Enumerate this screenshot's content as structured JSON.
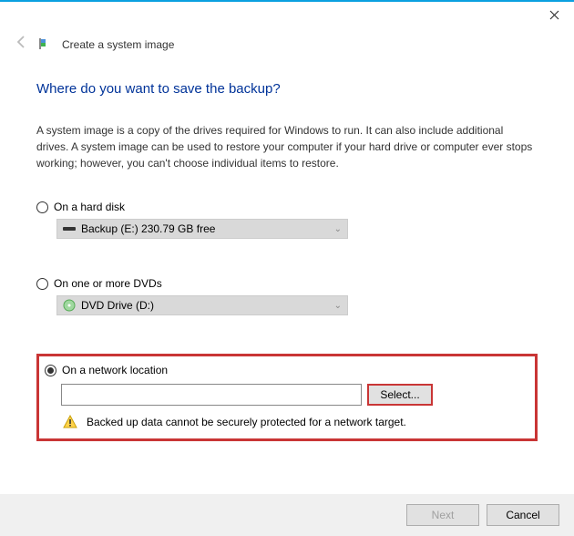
{
  "header": {
    "title": "Create a system image"
  },
  "main": {
    "heading": "Where do you want to save the backup?",
    "description": "A system image is a copy of the drives required for Windows to run. It can also include additional drives. A system image can be used to restore your computer if your hard drive or computer ever stops working; however, you can't choose individual items to restore."
  },
  "options": {
    "hard_disk": {
      "label": "On a hard disk",
      "selected_drive": "Backup (E:)  230.79 GB free"
    },
    "dvd": {
      "label": "On one or more DVDs",
      "selected_drive": "DVD Drive (D:)"
    },
    "network": {
      "label": "On a network location",
      "path_value": "",
      "select_button": "Select...",
      "warning": "Backed up data cannot be securely protected for a network target."
    }
  },
  "footer": {
    "next": "Next",
    "cancel": "Cancel"
  }
}
